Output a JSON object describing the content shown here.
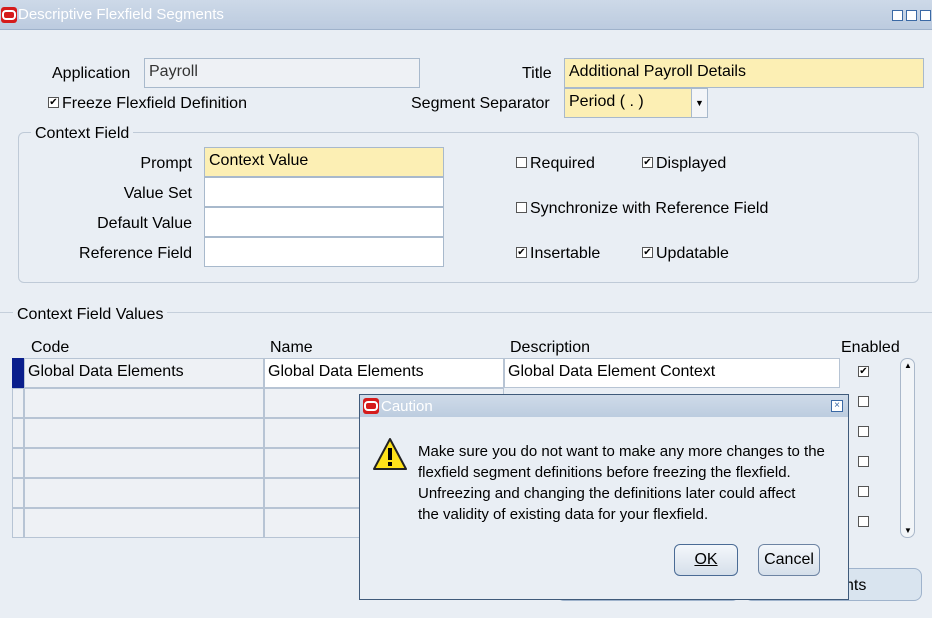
{
  "window": {
    "title": "Descriptive Flexfield Segments"
  },
  "form": {
    "application_label": "Application",
    "application_value": "Payroll",
    "title_label": "Title",
    "title_value": "Additional Payroll Details",
    "freeze_label": "Freeze Flexfield Definition",
    "freeze_checked": true,
    "separator_label": "Segment Separator",
    "separator_value": "Period ( . )"
  },
  "context_field": {
    "group_title": "Context Field",
    "prompt_label": "Prompt",
    "prompt_value": "Context Value",
    "value_set_label": "Value Set",
    "value_set_value": "",
    "default_value_label": "Default Value",
    "default_value_value": "",
    "reference_field_label": "Reference Field",
    "reference_field_value": "",
    "required_label": "Required",
    "displayed_label": "Displayed",
    "sync_label": "Synchronize with Reference Field",
    "insertable_label": "Insertable",
    "updatable_label": "Updatable"
  },
  "values_table": {
    "section_title": "Context Field Values",
    "headers": {
      "code": "Code",
      "name": "Name",
      "description": "Description",
      "enabled": "Enabled"
    },
    "rows": [
      {
        "code": "Global Data Elements",
        "name": "Global Data Elements",
        "description": "Global Data Element Context"
      }
    ]
  },
  "footer_button_partial": "nts",
  "dialog": {
    "title": "Caution",
    "message_line1": "Make sure you do not want to make any more changes to the",
    "message_line2": "flexfield segment definitions before freezing the flexfield.",
    "message_line3": "Unfreezing and changing the definitions later could affect",
    "message_line4": "the validity of existing data for your flexfield.",
    "ok_label": "OK",
    "cancel_label": "Cancel"
  },
  "colors": {
    "required_field": "#fcefb4",
    "title_bar": "#c5d3e4"
  }
}
